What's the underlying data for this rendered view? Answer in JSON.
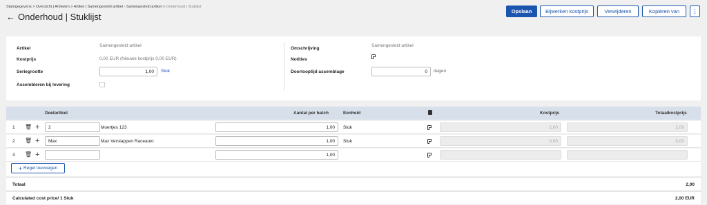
{
  "breadcrumb": {
    "path": "Stamgegevens > Overzicht | Artikelen > Artikel | Samengesteld artikel - Samengesteld artikel > ",
    "current": "Onderhoud | Stuklijst"
  },
  "page_title": "Onderhoud | Stuklijst",
  "toolbar": {
    "save": "Opslaan",
    "update_cost": "Bijwerken kostprijs",
    "delete": "Verwijderen",
    "copy_from": "Kopiëren van",
    "more": "⋮"
  },
  "form": {
    "artikel_label": "Artikel",
    "artikel_value": "Samengesteld artikel",
    "kostprijs_label": "Kostprijs",
    "kostprijs_value": "0,00  EUR (Nieuwe kostprijs  0,00  EUR)",
    "seriegrootte_label": "Seriegrootte",
    "seriegrootte_value": "1,00",
    "seriegrootte_unit": "Stuk",
    "assembleren_label": "Assembleren bij levering",
    "omschrijving_label": "Omschrijving",
    "omschrijving_value": "Samengesteld artikel",
    "notities_label": "Notities",
    "doorlooptijd_label": "Doorlooptijd assemblage",
    "doorlooptijd_value": "0",
    "doorlooptijd_unit": "dagen"
  },
  "table": {
    "columns": {
      "part": "Deelartikel",
      "qty": "Aantal per batch",
      "unit": "Eenheid",
      "cost": "Kostprijs",
      "total": "Totaalkostprijs"
    },
    "rows": [
      {
        "num": "1",
        "code": "2",
        "desc": "Moertjes 123",
        "qty": "1,00",
        "unit": "Stuk",
        "cost": "2,00",
        "total": "2,00"
      },
      {
        "num": "2",
        "code": "Max",
        "desc": "Max Verstappen Raceauto",
        "qty": "1,00",
        "unit": "Stuk",
        "cost": "0,00",
        "total": "0,00"
      },
      {
        "num": "3",
        "code": "",
        "desc": "",
        "qty": "1,00",
        "unit": "",
        "cost": "",
        "total": ""
      }
    ],
    "add_line": "Regel toevoegen"
  },
  "totals": {
    "total_label": "Totaal",
    "total_value": "2,00",
    "calc_label": "Calculated cost price/ 1 Stuk",
    "calc_value": "2,00 EUR"
  }
}
